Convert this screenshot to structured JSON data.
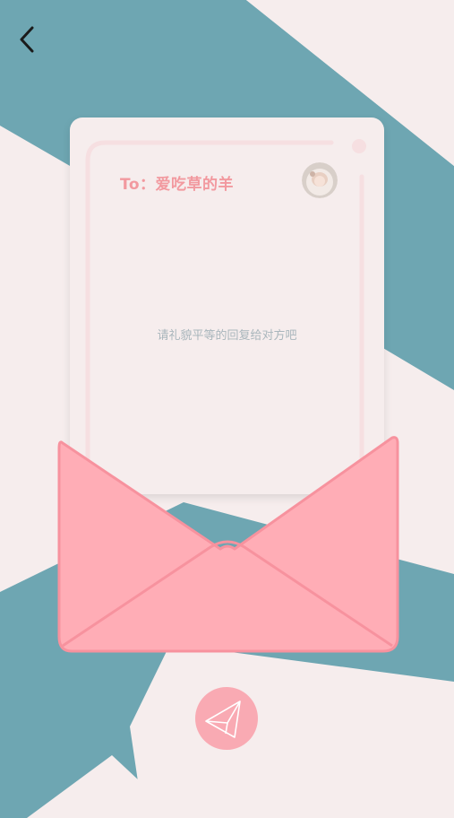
{
  "header": {
    "back_icon": "chevron-left-icon"
  },
  "letter": {
    "recipient": "To：爱吃草的羊",
    "avatar": "user-avatar",
    "reply_placeholder": "请礼貌平等的回复给对方吧"
  },
  "actions": {
    "send_icon": "paper-plane-icon"
  },
  "colors": {
    "background_teal": "#6ea6b2",
    "background_light": "#f6eded",
    "accent_pink": "#f9aab3",
    "envelope_pink": "#ffadb6",
    "envelope_stroke": "#f7929e",
    "recipient_text": "#f2999f",
    "placeholder_text": "#a9b6bc"
  }
}
